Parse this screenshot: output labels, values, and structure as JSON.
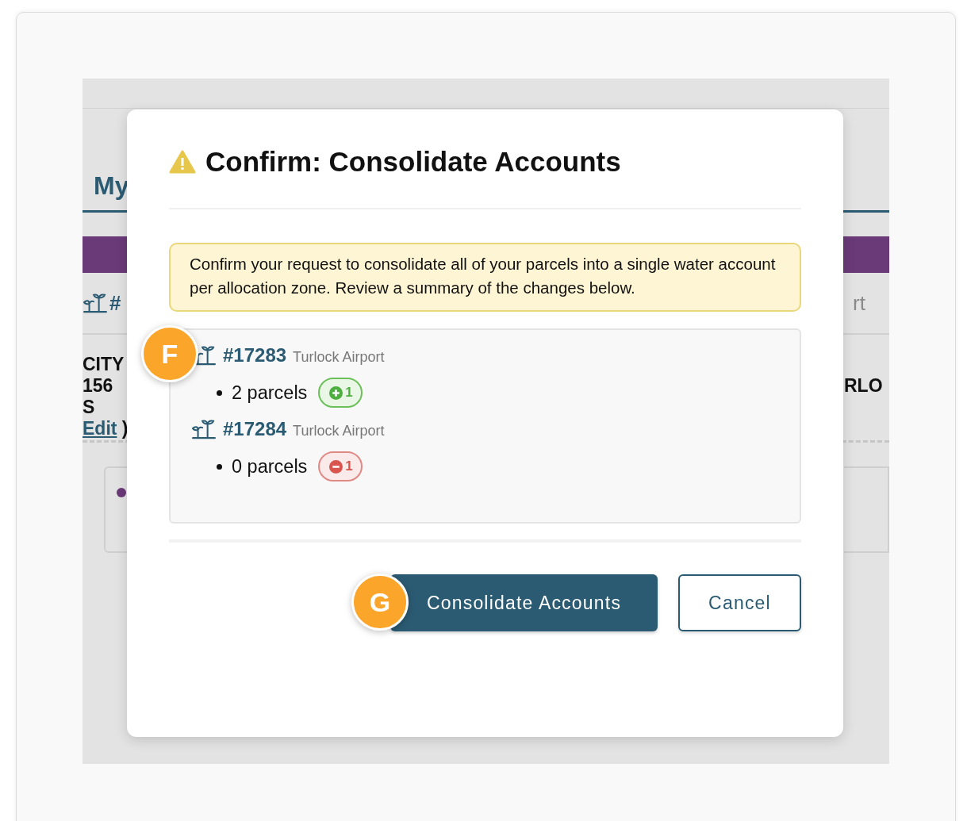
{
  "background_page": {
    "header_title": "My",
    "account_prefix": "#",
    "trailing_text": "rt",
    "address_lines": [
      "CITY",
      "156 S"
    ],
    "edit_link": "Edit",
    "edit_close": ")",
    "owner_text": "RLO"
  },
  "dialog": {
    "title": "Confirm: Consolidate Accounts",
    "message": "Confirm your request to consolidate all of your parcels into a single water account per allocation zone. Review a summary of the changes below.",
    "accounts": [
      {
        "number": "#17283",
        "zone": "Turlock Airport",
        "parcels": "2 parcels",
        "change": {
          "kind": "add",
          "count": "1"
        }
      },
      {
        "number": "#17284",
        "zone": "Turlock Airport",
        "parcels": "0 parcels",
        "change": {
          "kind": "remove",
          "count": "1"
        }
      }
    ],
    "buttons": [
      {
        "label": "Consolidate Accounts",
        "kind": "primary"
      },
      {
        "label": "Cancel",
        "kind": "secondary"
      }
    ]
  },
  "callouts": [
    {
      "label": "F"
    },
    {
      "label": "G"
    }
  ]
}
